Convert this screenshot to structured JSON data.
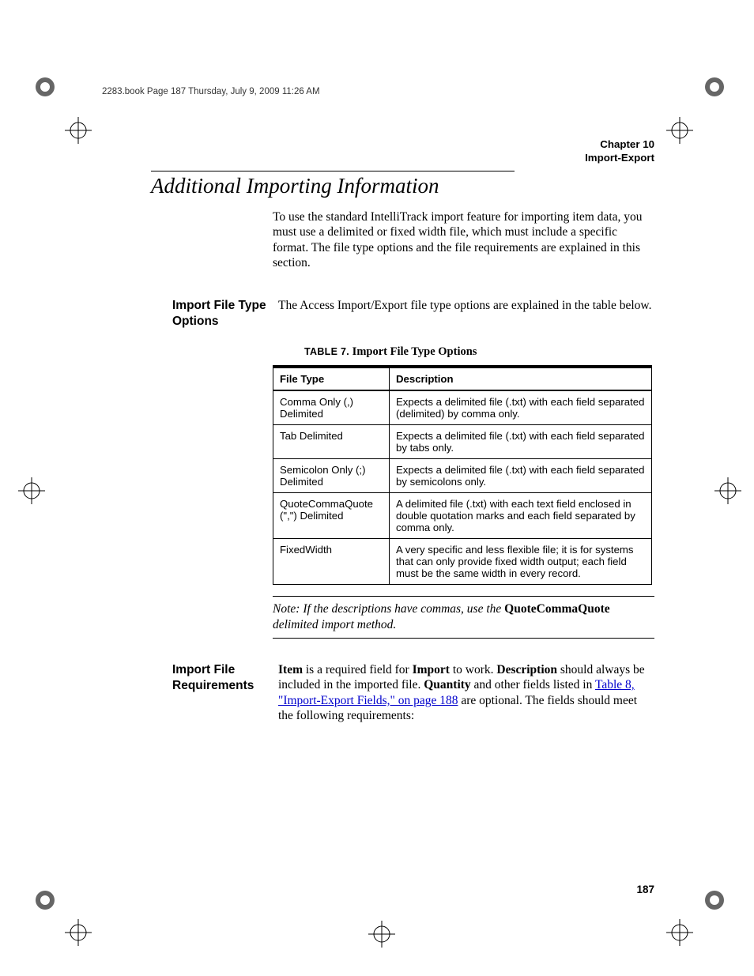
{
  "crop_header": "2283.book  Page 187  Thursday, July 9, 2009  11:26 AM",
  "running_head": {
    "line1": "Chapter 10",
    "line2": "Import-Export"
  },
  "h1": "Additional Importing Information",
  "intro": "To use the standard IntelliTrack import feature for importing item data, you must use a delimited or fixed width file, which must include a specific format. The file type options and the file requirements are explained in this section.",
  "sections": {
    "file_type_options": {
      "label": "Import File Type Options",
      "body": "The Access Import/Export file type options are explained in the table below."
    },
    "file_requirements": {
      "label": "Import File Requirements",
      "body_parts": {
        "p1a": "Item",
        "p1b": " is a required field for ",
        "p1c": "Import",
        "p1d": " to work. ",
        "p1e": "Description",
        "p1f": " should always be included in the imported file. ",
        "p1g": "Quantity",
        "p1h": " and other fields listed in ",
        "link": "Table 8, \"Import-Export Fields,\" on page 188",
        "p1i": " are optional. The fields should meet the following requirements:"
      }
    }
  },
  "table": {
    "caption_label": "TABLE 7.",
    "caption_title": " Import File Type Options",
    "headers": {
      "c1": "File Type",
      "c2": "Description"
    },
    "rows": [
      {
        "c1": "Comma Only (,) Delimited",
        "c2": "Expects a delimited file (.txt) with each field separated (delimited) by comma only."
      },
      {
        "c1": "Tab Delimited",
        "c2": "Expects a delimited file (.txt) with each field separated by tabs only."
      },
      {
        "c1": "Semicolon Only (;) Delimited",
        "c2": "Expects a delimited file (.txt) with each field separated by semicolons only."
      },
      {
        "c1": "QuoteCommaQuote (\",\") Delimited",
        "c2": "A delimited file (.txt) with each text field enclosed in double quotation marks and each field separated by comma only."
      },
      {
        "c1": "FixedWidth",
        "c2": "A very specific and less flexible file; it is for systems that can only provide fixed width output; each field must be the same width in every record."
      }
    ]
  },
  "note": {
    "label": "Note:",
    "body_a": "   If the descriptions have commas, use the ",
    "body_bold": "QuoteCommaQuote",
    "body_b": " delimited import method."
  },
  "folio": "187"
}
